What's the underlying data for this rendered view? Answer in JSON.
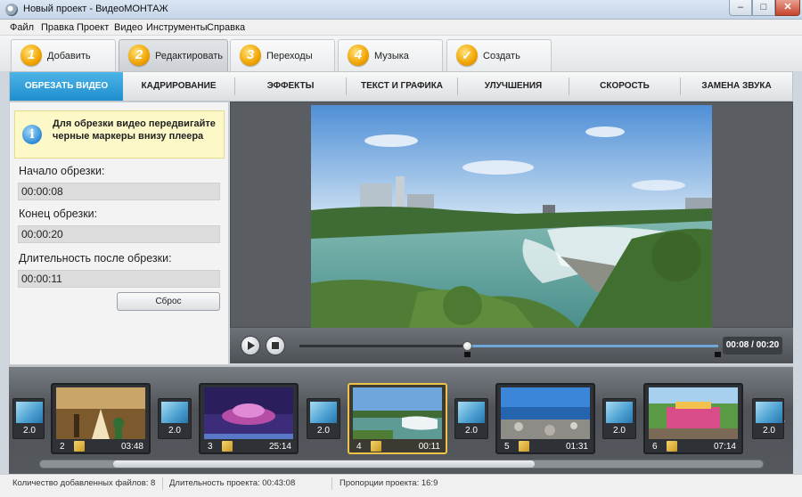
{
  "window": {
    "title": "Новый проект - ВидеоМОНТАЖ"
  },
  "menu": [
    "Файл",
    "Правка",
    "Проект",
    "Видео",
    "Инструменты",
    "Справка"
  ],
  "steps": [
    {
      "num": "1",
      "label": "Добавить"
    },
    {
      "num": "2",
      "label": "Редактировать"
    },
    {
      "num": "3",
      "label": "Переходы"
    },
    {
      "num": "4",
      "label": "Музыка"
    },
    {
      "num": "✓",
      "label": "Создать"
    }
  ],
  "subtabs": [
    "ОБРЕЗАТЬ ВИДЕО",
    "КАДРИРОВАНИЕ",
    "ЭФФЕКТЫ",
    "ТЕКСТ И ГРАФИКА",
    "УЛУЧШЕНИЯ",
    "СКОРОСТЬ",
    "ЗАМЕНА ЗВУКА"
  ],
  "trim": {
    "info": "Для обрезки видео передвигайте черные маркеры внизу плеера",
    "start_label": "Начало обрезки:",
    "start_value": "00:00:08",
    "end_label": "Конец обрезки:",
    "end_value": "00:00:20",
    "duration_label": "Длительность после обрезки:",
    "duration_value": "00:00:11",
    "reset": "Сброс"
  },
  "player": {
    "time": "00:08 / 00:20",
    "position": 0.4,
    "trim_start": 0.4,
    "trim_end": 1.0
  },
  "timeline": {
    "transition_label": "2.0",
    "clips": [
      {
        "num": "2",
        "duration": "03:48"
      },
      {
        "num": "3",
        "duration": "25:14"
      },
      {
        "num": "4",
        "duration": "00:11"
      },
      {
        "num": "5",
        "duration": "01:31"
      },
      {
        "num": "6",
        "duration": "07:14"
      }
    ]
  },
  "status": {
    "files": "Количество добавленных файлов: 8",
    "duration": "Длительность проекта:  00:43:08",
    "aspect": "Пропорции проекта:  16:9"
  },
  "colors": {
    "accent": "#2196d3",
    "highlight": "#eec24a"
  }
}
